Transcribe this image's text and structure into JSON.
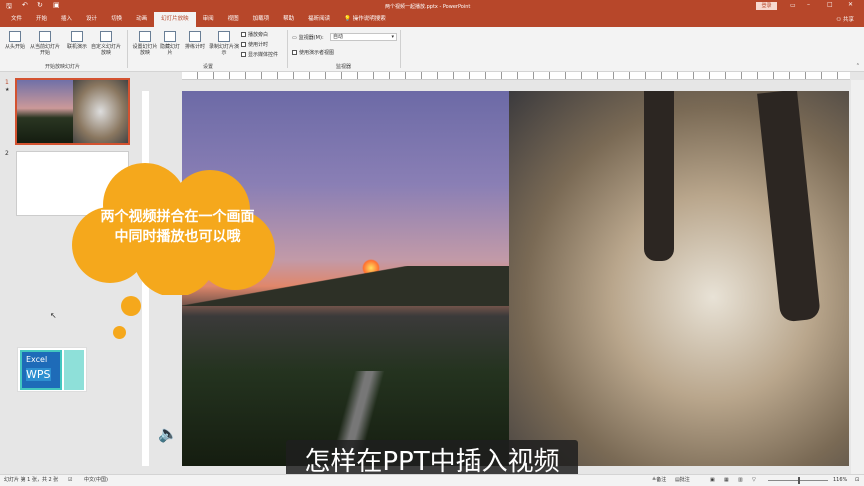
{
  "titlebar": {
    "quick_access": [
      "save",
      "undo",
      "redo",
      "start-from-beginning"
    ],
    "title": "两个视频一起播放.pptx  -  PowerPoint",
    "login": "登录"
  },
  "tabs": [
    {
      "label": "文件"
    },
    {
      "label": "开始"
    },
    {
      "label": "插入"
    },
    {
      "label": "设计"
    },
    {
      "label": "切换"
    },
    {
      "label": "动画"
    },
    {
      "label": "幻灯片放映",
      "active": true
    },
    {
      "label": "审阅"
    },
    {
      "label": "视图"
    },
    {
      "label": "加载项"
    },
    {
      "label": "帮助"
    },
    {
      "label": "福昕阅读"
    },
    {
      "label": "操作说明搜索"
    }
  ],
  "share": "共享",
  "ribbon": {
    "buttons": [
      "从头开始",
      "从当前幻灯片开始",
      "联机演示",
      "自定义幻灯片放映",
      "设置幻灯片放映",
      "隐藏幻灯片",
      "排练计时",
      "录制幻灯片演示"
    ],
    "checks": [
      {
        "label": "播放旁白",
        "checked": true
      },
      {
        "label": "使用计时",
        "checked": true
      },
      {
        "label": "显示媒体控件",
        "checked": true
      },
      {
        "label": "使用演示者视图",
        "checked": true
      }
    ],
    "monitor_label": "监视器(M):",
    "monitor_value": "自动",
    "groups": [
      "开始放映幻灯片",
      "设置",
      "监视器"
    ]
  },
  "thumbnails": [
    {
      "number": "1"
    },
    {
      "number": "2"
    }
  ],
  "callout": "两个视频拼合在一个画面中同时播放也可以哦",
  "logo": {
    "line1": "Excel",
    "line2": "WPS"
  },
  "subtitle": "怎样在PPT中插入视频",
  "status": {
    "slide_info": "幻灯片 第 1 张，共 2 张",
    "language": "中文(中国)",
    "notes": "备注",
    "comments": "批注",
    "zoom": "116%"
  },
  "colors": {
    "accent": "#b7472a",
    "callout": "#f5a81c"
  }
}
